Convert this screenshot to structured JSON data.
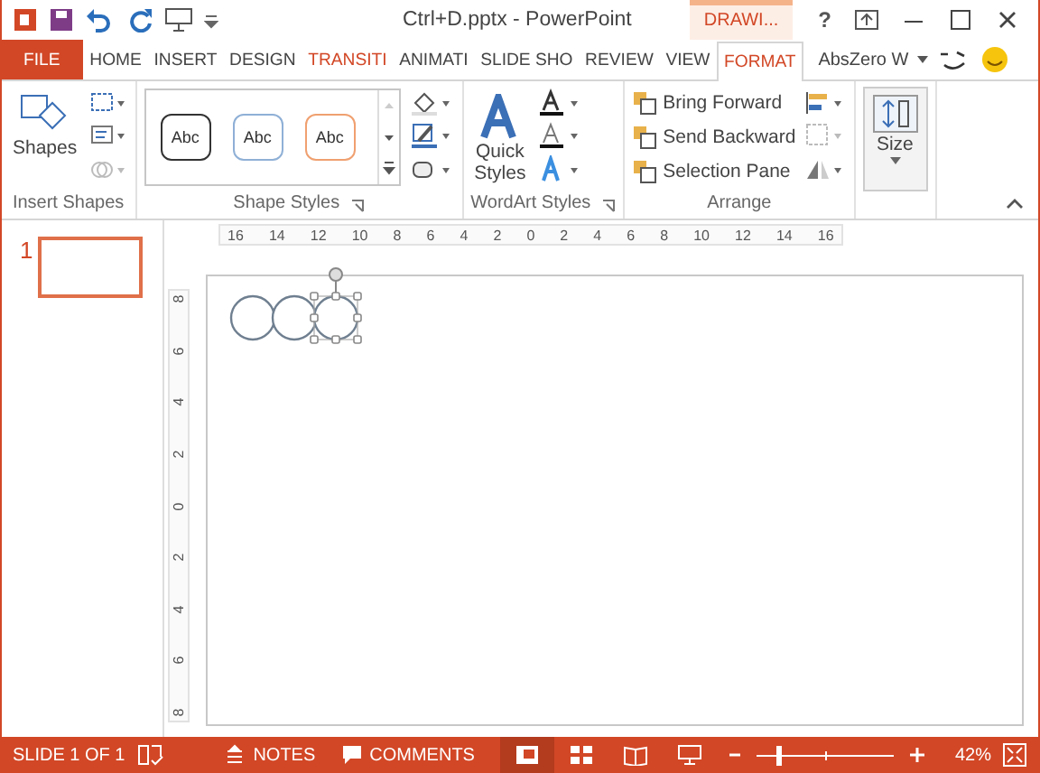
{
  "window": {
    "title": "Ctrl+D.pptx - PowerPoint",
    "context_tab": "DRAWI...",
    "help": "?"
  },
  "tabs": [
    {
      "label": "FILE",
      "kind": "file",
      "selected": false
    },
    {
      "label": "HOME",
      "kind": "tab",
      "selected": false
    },
    {
      "label": "INSERT",
      "kind": "tab",
      "selected": false
    },
    {
      "label": "DESIGN",
      "kind": "tab",
      "selected": false
    },
    {
      "label": "TRANSITI",
      "kind": "accent",
      "selected": false
    },
    {
      "label": "ANIMATI",
      "kind": "tab",
      "selected": false
    },
    {
      "label": "SLIDE SHO",
      "kind": "tab",
      "selected": false
    },
    {
      "label": "REVIEW",
      "kind": "tab",
      "selected": false
    },
    {
      "label": "VIEW",
      "kind": "tab",
      "selected": false
    },
    {
      "label": "FORMAT",
      "kind": "accent",
      "selected": true
    }
  ],
  "account": "AbsZero W",
  "ribbon": {
    "insert_shapes": {
      "button": "Shapes",
      "label": "Insert Shapes"
    },
    "shape_styles": {
      "samples": [
        {
          "text": "Abc",
          "color": "#333333"
        },
        {
          "text": "Abc",
          "color": "#8fb0d6"
        },
        {
          "text": "Abc",
          "color": "#f0a070"
        }
      ],
      "label": "Shape Styles"
    },
    "wordart": {
      "button_line1": "Quick",
      "button_line2": "Styles",
      "label": "WordArt Styles"
    },
    "arrange": {
      "items": [
        "Bring Forward",
        "Send Backward",
        "Selection Pane"
      ],
      "label": "Arrange"
    },
    "size": {
      "button": "Size"
    }
  },
  "ruler": {
    "horizontal": [
      "16",
      "14",
      "12",
      "10",
      "8",
      "6",
      "4",
      "2",
      "0",
      "2",
      "4",
      "6",
      "8",
      "10",
      "12",
      "14",
      "16"
    ],
    "vertical": [
      "8",
      "6",
      "4",
      "2",
      "0",
      "2",
      "4",
      "6",
      "8"
    ]
  },
  "thumbnails": [
    {
      "number": "1",
      "selected": true
    }
  ],
  "slide": {
    "shapes": [
      {
        "kind": "circle",
        "selected": false
      },
      {
        "kind": "circle",
        "selected": false
      },
      {
        "kind": "circle",
        "selected": true
      }
    ]
  },
  "status_bar": {
    "slide": "SLIDE 1 OF 1",
    "notes": "NOTES",
    "comments": "COMMENTS",
    "views": [
      {
        "kind": "normal",
        "selected": true
      },
      {
        "kind": "sorter",
        "selected": false
      },
      {
        "kind": "reading",
        "selected": false
      },
      {
        "kind": "show",
        "selected": false
      }
    ],
    "zoom": {
      "level": 0.15,
      "reading": "42%"
    }
  }
}
